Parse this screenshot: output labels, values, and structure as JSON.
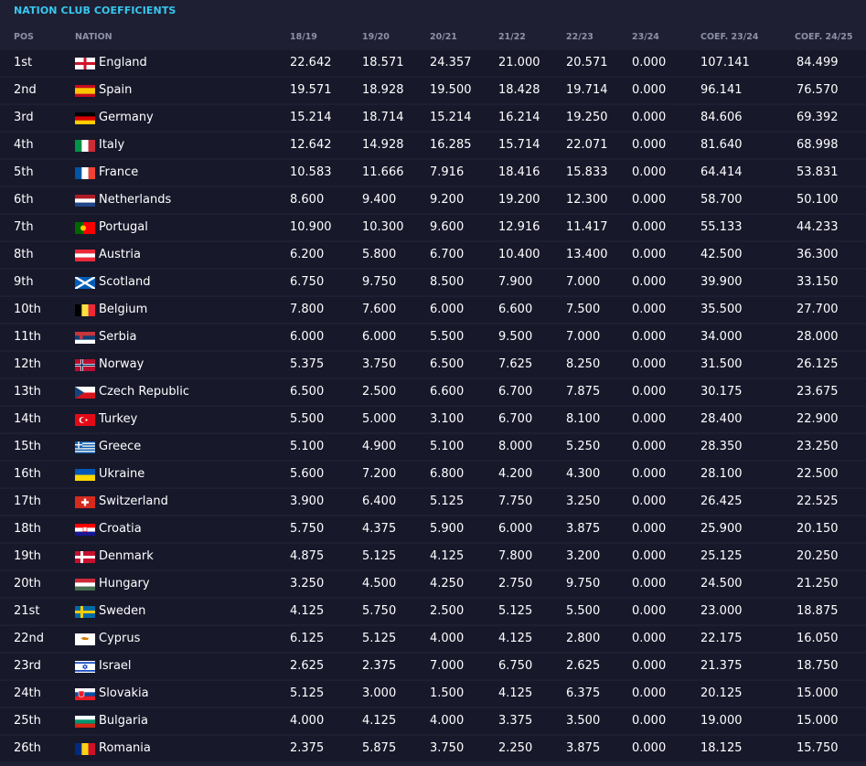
{
  "title": "NATION CLUB COEFFICIENTS",
  "columns": [
    "POS",
    "NATION",
    "18/19",
    "19/20",
    "20/21",
    "21/22",
    "22/23",
    "23/24",
    "COEF. 23/24",
    "COEF. 24/25"
  ],
  "rows": [
    {
      "pos": "1st",
      "nation": "England",
      "flag": "england",
      "v": [
        "22.642",
        "18.571",
        "24.357",
        "21.000",
        "20.571",
        "0.000",
        "107.141",
        "84.499"
      ]
    },
    {
      "pos": "2nd",
      "nation": "Spain",
      "flag": "spain",
      "v": [
        "19.571",
        "18.928",
        "19.500",
        "18.428",
        "19.714",
        "0.000",
        "96.141",
        "76.570"
      ]
    },
    {
      "pos": "3rd",
      "nation": "Germany",
      "flag": "germany",
      "v": [
        "15.214",
        "18.714",
        "15.214",
        "16.214",
        "19.250",
        "0.000",
        "84.606",
        "69.392"
      ]
    },
    {
      "pos": "4th",
      "nation": "Italy",
      "flag": "italy",
      "v": [
        "12.642",
        "14.928",
        "16.285",
        "15.714",
        "22.071",
        "0.000",
        "81.640",
        "68.998"
      ]
    },
    {
      "pos": "5th",
      "nation": "France",
      "flag": "france",
      "v": [
        "10.583",
        "11.666",
        "7.916",
        "18.416",
        "15.833",
        "0.000",
        "64.414",
        "53.831"
      ]
    },
    {
      "pos": "6th",
      "nation": "Netherlands",
      "flag": "netherlands",
      "v": [
        "8.600",
        "9.400",
        "9.200",
        "19.200",
        "12.300",
        "0.000",
        "58.700",
        "50.100"
      ]
    },
    {
      "pos": "7th",
      "nation": "Portugal",
      "flag": "portugal",
      "v": [
        "10.900",
        "10.300",
        "9.600",
        "12.916",
        "11.417",
        "0.000",
        "55.133",
        "44.233"
      ]
    },
    {
      "pos": "8th",
      "nation": "Austria",
      "flag": "austria",
      "v": [
        "6.200",
        "5.800",
        "6.700",
        "10.400",
        "13.400",
        "0.000",
        "42.500",
        "36.300"
      ]
    },
    {
      "pos": "9th",
      "nation": "Scotland",
      "flag": "scotland",
      "v": [
        "6.750",
        "9.750",
        "8.500",
        "7.900",
        "7.000",
        "0.000",
        "39.900",
        "33.150"
      ]
    },
    {
      "pos": "10th",
      "nation": "Belgium",
      "flag": "belgium",
      "v": [
        "7.800",
        "7.600",
        "6.000",
        "6.600",
        "7.500",
        "0.000",
        "35.500",
        "27.700"
      ]
    },
    {
      "pos": "11th",
      "nation": "Serbia",
      "flag": "serbia",
      "v": [
        "6.000",
        "6.000",
        "5.500",
        "9.500",
        "7.000",
        "0.000",
        "34.000",
        "28.000"
      ]
    },
    {
      "pos": "12th",
      "nation": "Norway",
      "flag": "norway",
      "v": [
        "5.375",
        "3.750",
        "6.500",
        "7.625",
        "8.250",
        "0.000",
        "31.500",
        "26.125"
      ]
    },
    {
      "pos": "13th",
      "nation": "Czech Republic",
      "flag": "czech",
      "v": [
        "6.500",
        "2.500",
        "6.600",
        "6.700",
        "7.875",
        "0.000",
        "30.175",
        "23.675"
      ]
    },
    {
      "pos": "14th",
      "nation": "Turkey",
      "flag": "turkey",
      "v": [
        "5.500",
        "5.000",
        "3.100",
        "6.700",
        "8.100",
        "0.000",
        "28.400",
        "22.900"
      ]
    },
    {
      "pos": "15th",
      "nation": "Greece",
      "flag": "greece",
      "v": [
        "5.100",
        "4.900",
        "5.100",
        "8.000",
        "5.250",
        "0.000",
        "28.350",
        "23.250"
      ]
    },
    {
      "pos": "16th",
      "nation": "Ukraine",
      "flag": "ukraine",
      "v": [
        "5.600",
        "7.200",
        "6.800",
        "4.200",
        "4.300",
        "0.000",
        "28.100",
        "22.500"
      ]
    },
    {
      "pos": "17th",
      "nation": "Switzerland",
      "flag": "switzerland",
      "v": [
        "3.900",
        "6.400",
        "5.125",
        "7.750",
        "3.250",
        "0.000",
        "26.425",
        "22.525"
      ]
    },
    {
      "pos": "18th",
      "nation": "Croatia",
      "flag": "croatia",
      "v": [
        "5.750",
        "4.375",
        "5.900",
        "6.000",
        "3.875",
        "0.000",
        "25.900",
        "20.150"
      ]
    },
    {
      "pos": "19th",
      "nation": "Denmark",
      "flag": "denmark",
      "v": [
        "4.875",
        "5.125",
        "4.125",
        "7.800",
        "3.200",
        "0.000",
        "25.125",
        "20.250"
      ]
    },
    {
      "pos": "20th",
      "nation": "Hungary",
      "flag": "hungary",
      "v": [
        "3.250",
        "4.500",
        "4.250",
        "2.750",
        "9.750",
        "0.000",
        "24.500",
        "21.250"
      ]
    },
    {
      "pos": "21st",
      "nation": "Sweden",
      "flag": "sweden",
      "v": [
        "4.125",
        "5.750",
        "2.500",
        "5.125",
        "5.500",
        "0.000",
        "23.000",
        "18.875"
      ]
    },
    {
      "pos": "22nd",
      "nation": "Cyprus",
      "flag": "cyprus",
      "v": [
        "6.125",
        "5.125",
        "4.000",
        "4.125",
        "2.800",
        "0.000",
        "22.175",
        "16.050"
      ]
    },
    {
      "pos": "23rd",
      "nation": "Israel",
      "flag": "israel",
      "v": [
        "2.625",
        "2.375",
        "7.000",
        "6.750",
        "2.625",
        "0.000",
        "21.375",
        "18.750"
      ]
    },
    {
      "pos": "24th",
      "nation": "Slovakia",
      "flag": "slovakia",
      "v": [
        "5.125",
        "3.000",
        "1.500",
        "4.125",
        "6.375",
        "0.000",
        "20.125",
        "15.000"
      ]
    },
    {
      "pos": "25th",
      "nation": "Bulgaria",
      "flag": "bulgaria",
      "v": [
        "4.000",
        "4.125",
        "4.000",
        "3.375",
        "3.500",
        "0.000",
        "19.000",
        "15.000"
      ]
    },
    {
      "pos": "26th",
      "nation": "Romania",
      "flag": "romania",
      "v": [
        "2.375",
        "5.875",
        "3.750",
        "2.250",
        "3.875",
        "0.000",
        "18.125",
        "15.750"
      ]
    }
  ]
}
